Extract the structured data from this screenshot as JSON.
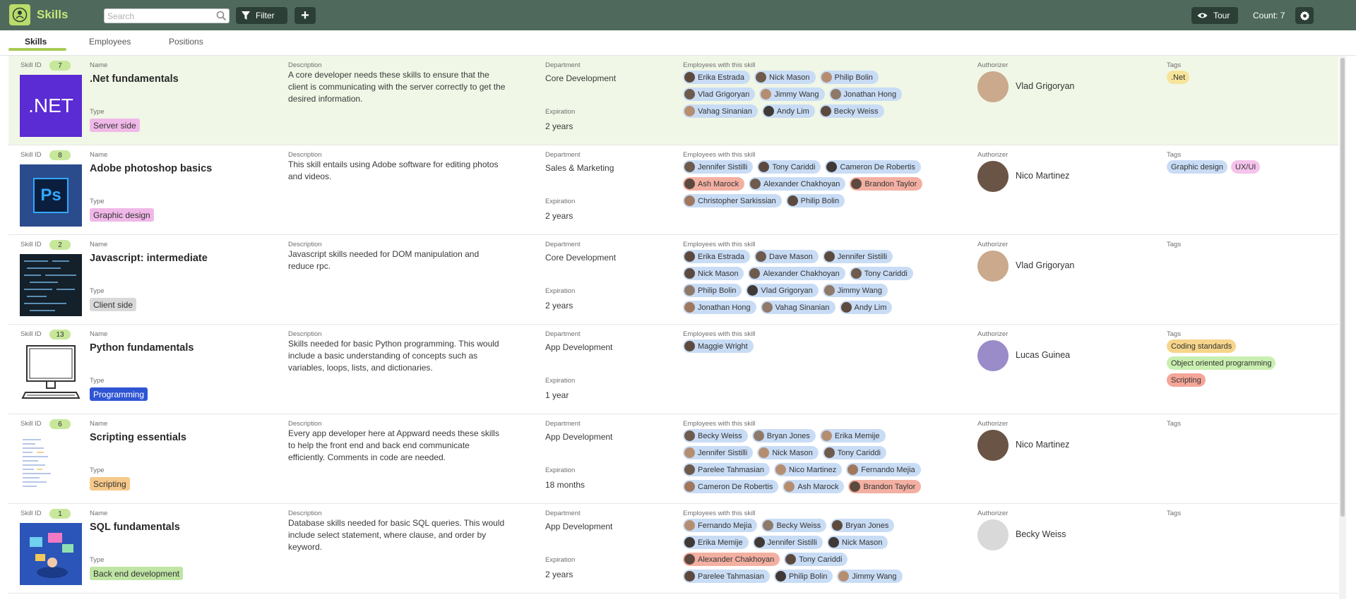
{
  "header": {
    "app_title": "Skills",
    "search_placeholder": "Search",
    "filter_label": "Filter",
    "add_label": "+",
    "tour_label": "Tour",
    "count_text": "Count: 7",
    "accent": "#b9dc6a",
    "bar_color": "#4f6a5c"
  },
  "tabs": [
    {
      "label": "Skills",
      "active": true
    },
    {
      "label": "Employees",
      "active": false
    },
    {
      "label": "Positions",
      "active": false
    }
  ],
  "labels": {
    "skill_id": "Skill ID",
    "name": "Name",
    "type": "Type",
    "description": "Description",
    "department": "Department",
    "expiration": "Expiration",
    "employees": "Employees with this skill",
    "authorizer": "Authorizer",
    "tags": "Tags"
  },
  "rows": [
    {
      "id": "7",
      "name": ".Net fundamentals",
      "type": "Server side",
      "type_color": "#f0b8e8",
      "description": "A core developer needs these skills to ensure that the client is communicating with the server correctly to get the desired information.",
      "department": "Core Development",
      "expiration": "2 years",
      "employees": [
        "Erika Estrada",
        "Nick Mason",
        "Philip Bolin",
        "Vlad Grigoryan",
        "Jimmy Wang",
        "Jonathan Hong",
        "Vahag Sinanian",
        "Andy Lim",
        "Becky Weiss"
      ],
      "authorizer": "Vlad Grigoryan",
      "tags": [
        ".Net"
      ],
      "thumb_text": ".NET"
    },
    {
      "id": "8",
      "name": "Adobe photoshop basics",
      "type": "Graphic design",
      "type_color": "#f0b8e8",
      "description": "This skill entails using Adobe software for editing photos and videos.",
      "department": "Sales & Marketing",
      "expiration": "2 years",
      "employees": [
        "Jennifer Sistilli",
        "Tony Cariddi",
        "Cameron De Robertis",
        "Ash Marock",
        "Alexander Chakhoyan",
        "Brandon Taylor",
        "Christopher Sarkissian",
        "Philip Bolin"
      ],
      "authorizer": "Nico Martinez",
      "tags": [
        "Graphic design",
        "UX/UI"
      ],
      "thumb_text": "Ps"
    },
    {
      "id": "2",
      "name": "Javascript: intermediate",
      "type": "Client side",
      "type_color": "#d9d9d9",
      "description": "Javascript skills needed for DOM manipulation and reduce rpc.",
      "department": "Core Development",
      "expiration": "2 years",
      "employees": [
        "Erika Estrada",
        "Dave Mason",
        "Jennifer Sistilli",
        "Nick Mason",
        "Alexander Chakhoyan",
        "Tony Cariddi",
        "Philip Bolin",
        "Vlad Grigoryan",
        "Jimmy Wang",
        "Jonathan Hong",
        "Vahag Sinanian",
        "Andy Lim"
      ],
      "authorizer": "Vlad Grigoryan",
      "tags": [],
      "thumb_text": ""
    },
    {
      "id": "13",
      "name": "Python fundamentals",
      "type": "Programming",
      "type_color": "#2f55d4",
      "description": "Skills needed for basic Python programming. This would include a basic understanding of concepts such as variables, loops, lists, and dictionaries.",
      "department": "App Development",
      "expiration": "1 year",
      "employees": [
        "Maggie Wright"
      ],
      "authorizer": "Lucas Guinea",
      "tags": [
        "Coding standards",
        "Object oriented programming",
        "Scripting"
      ],
      "thumb_text": ""
    },
    {
      "id": "6",
      "name": "Scripting essentials",
      "type": "Scripting",
      "type_color": "#f6c98a",
      "description": "Every app developer here at Appward needs these skills to help the front end and back end communicate efficiently. Comments in code are needed.",
      "department": "App Development",
      "expiration": "18 months",
      "employees": [
        "Becky Weiss",
        "Bryan Jones",
        "Erika Memije",
        "Jennifer Sistilli",
        "Nick Mason",
        "Tony Cariddi",
        "Parelee Tahmasian",
        "Nico Martinez",
        "Fernando Mejia",
        "Cameron De Robertis",
        "Ash Marock",
        "Brandon Taylor"
      ],
      "authorizer": "Nico Martinez",
      "tags": [],
      "thumb_text": ""
    },
    {
      "id": "1",
      "name": "SQL fundamentals",
      "type": "Back end development",
      "type_color": "#bfe4a4",
      "description": "Database skills needed for basic SQL queries. This would include select statement, where clause, and order by keyword.",
      "department": "App Development",
      "expiration": "2 years",
      "employees": [
        "Fernando Mejia",
        "Becky Weiss",
        "Bryan Jones",
        "Erika Memije",
        "Jennifer Sistilli",
        "Nick Mason",
        "Alexander Chakhoyan",
        "Tony Cariddi",
        "Parelee Tahmasian",
        "Philip Bolin",
        "Jimmy Wang"
      ],
      "authorizer": "Becky Weiss",
      "tags": [],
      "thumb_text": ""
    }
  ]
}
